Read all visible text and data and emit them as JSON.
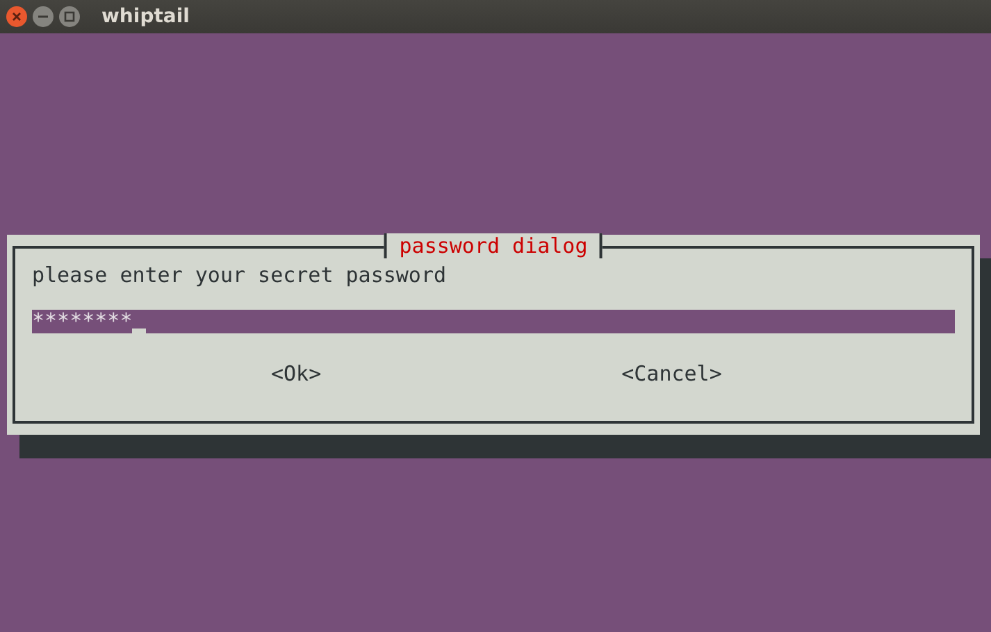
{
  "window": {
    "title": "whiptail"
  },
  "dialog": {
    "title": "password dialog",
    "prompt": "please enter your secret password",
    "password": {
      "value": "********"
    },
    "buttons": [
      {
        "label": "<Ok>"
      },
      {
        "label": "<Cancel>"
      }
    ]
  }
}
